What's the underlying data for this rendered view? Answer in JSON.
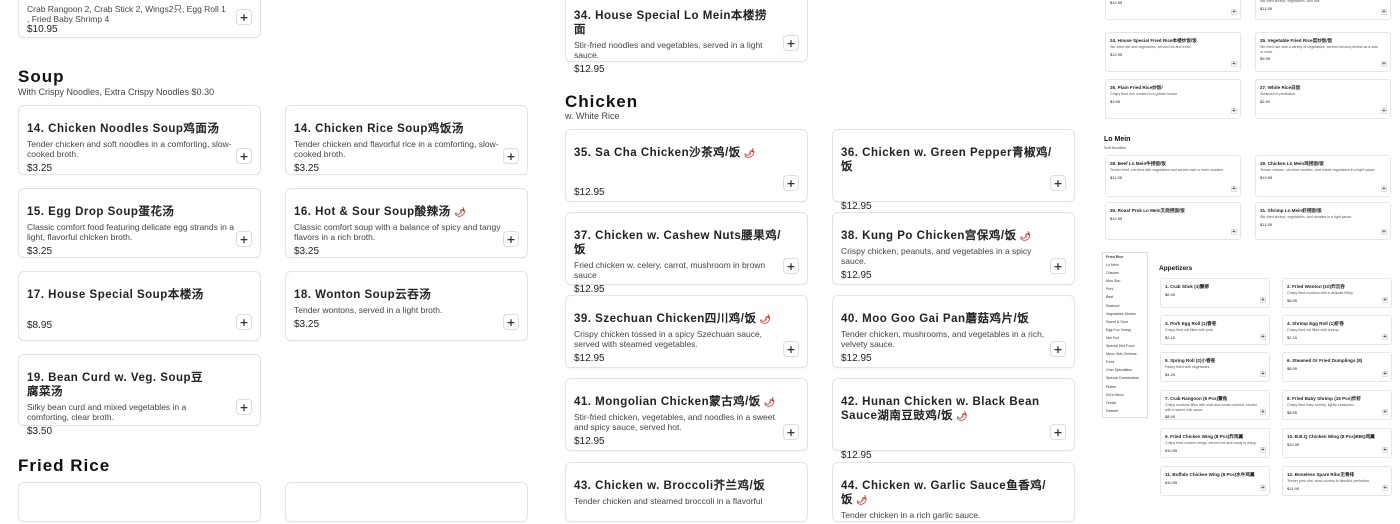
{
  "partial_top": {
    "desc": "Crab Rangoon 2, Crab Stick 2, Wings2只, Egg Roll 1 , Fried Baby Shrimp 4",
    "price": "$10.95"
  },
  "item34": {
    "title": "34. House Special Lo Mein本楼捞面",
    "desc": "Stir-fried noodles and vegetables, served in a light sauce.",
    "price": "$12.95"
  },
  "soup": {
    "title": "Soup",
    "subtitle": "With Crispy Noodles, Extra Crispy Noodles $0.30",
    "items": [
      {
        "title": "14. Chicken Noodles Soup鸡面汤",
        "desc": "Tender chicken and soft noodles in a comforting, slow-cooked broth.",
        "price": "$3.25"
      },
      {
        "title": "14. Chicken Rice Soup鸡饭汤",
        "desc": "Tender chicken and flavorful rice in a comforting, slow-cooked broth.",
        "price": "$3.25"
      },
      {
        "title": "15. Egg Drop Soup蛋花汤",
        "desc": "Classic comfort food featuring delicate egg strands in a light, flavorful chicken broth.",
        "price": "$3.25"
      },
      {
        "title": "16. Hot & Sour Soup酸辣汤",
        "desc": "Classic comfort soup with a balance of spicy and tangy flavors in a rich broth.",
        "price": "$3.25"
      },
      {
        "title": "17. House Special Soup本楼汤",
        "desc": "",
        "price": "$8.95"
      },
      {
        "title": "18. Wonton Soup云吞汤",
        "desc": "Tender wontons, served in a light broth.",
        "price": "$3.25"
      },
      {
        "title": "19. Bean Curd w. Veg. Soup豆腐菜汤",
        "desc": "Silky bean curd and mixed vegetables in a comforting, clear broth.",
        "price": "$3.50"
      }
    ]
  },
  "fried_rice": {
    "title": "Fried Rice"
  },
  "chicken": {
    "title": "Chicken",
    "subtitle": "w. White Rice",
    "items": [
      {
        "title": "35. Sa Cha Chicken沙茶鸡/饭",
        "desc": "",
        "price": "$12.95"
      },
      {
        "title": "36. Chicken w. Green Pepper青椒鸡/饭",
        "desc": "",
        "price": "$12.95"
      },
      {
        "title": "37. Chicken w. Cashew Nuts腰果鸡/饭",
        "desc": "Fried chicken w. celery, carrot, mushroom in brown sauce",
        "price": "$12.95"
      },
      {
        "title": "38. Kung Po Chicken宫保鸡/饭",
        "desc": "Crispy chicken, peanuts, and vegetables in a spicy sauce.",
        "price": "$12.95"
      },
      {
        "title": "39. Szechuan Chicken四川鸡/饭",
        "desc": "Crispy chicken tossed in a spicy Szechuan sauce, served with steamed vegetables.",
        "price": "$12.95"
      },
      {
        "title": "40. Moo Goo Gai Pan蘑菇鸡片/饭",
        "desc": "Tender chicken, mushrooms, and vegetables in a rich, velvety sauce.",
        "price": "$12.95"
      },
      {
        "title": "41. Mongolian Chicken蒙古鸡/饭",
        "desc": "Stir-fried chicken, vegetables, and noodles in a sweet and spicy sauce, served hot.",
        "price": "$12.95"
      },
      {
        "title": "42. Hunan Chicken w. Black Bean Sauce湖南豆豉鸡/饭",
        "desc": "",
        "price": "$12.95"
      },
      {
        "title": "43. Chicken w. Broccoli芥兰鸡/饭",
        "desc": "Tender chicken and steamed broccoli in a flavorful",
        "price": ""
      },
      {
        "title": "44. Chicken w. Garlic Sauce鱼香鸡/饭",
        "desc": "Tender chicken in a rich garlic sauce.",
        "price": ""
      }
    ]
  },
  "thumb": {
    "fr_items": [
      {
        "title": "",
        "desc": "",
        "price": "$10.95"
      },
      {
        "title": "",
        "desc": "Stir-fried shrimp, vegetables, and rice",
        "price": "$11.95"
      },
      {
        "title": "24. House Special Fried Rice本楼炒饭/饭",
        "desc": "Stir-fried rice and vegetables, served hot and fresh.",
        "price": "$12.95"
      },
      {
        "title": "25. Vegetable Fried Rice菜炒饭/饭",
        "desc": "Stir-fried rice with a variety of vegetables, served hot and perfect as a side or meal.",
        "price": "$9.95"
      },
      {
        "title": "26. Plain Fried Rice炒饭/",
        "desc": "Crispy fried rice cooked to a golden brown.",
        "price": "$3.95"
      },
      {
        "title": "27. White Rice白饭",
        "desc": "Steamed to perfection.",
        "price": "$2.50"
      }
    ],
    "lomein": {
      "title": "Lo Mein",
      "subtitle": "Soft Noodles"
    },
    "lm_items": [
      {
        "title": "28. Beef Lo Mein牛捞面/饭",
        "desc": "Tender beef, stir-fried with vegetables and served over lo mein noodles.",
        "price": "$11.95"
      },
      {
        "title": "29. Chicken Lo Mein鸡捞面/饭",
        "desc": "Tender chicken, stir-fried noodles, and mixed vegetables in a light sauce.",
        "price": "$10.95"
      },
      {
        "title": "30. Roast Prok Lo Mein叉烧捞面/饭",
        "desc": "",
        "price": "$10.95"
      },
      {
        "title": "31. Shrimp Lo Mein虾捞面/饭",
        "desc": "Stir-fried shrimp, vegetables, and noodles in a light sauce.",
        "price": "$11.95"
      }
    ],
    "nav": [
      "Fried Rice",
      "Lo Mein",
      "Chicken",
      "Moo Shu",
      "Pork",
      "Beef",
      "Seafood",
      "Vegetables Dishes",
      "Sweet & Sour",
      "Egg Foo Young",
      "Mei Fun",
      "Special Diet Food",
      "Menu Sub-Chinese Food",
      "Chef Specialties",
      "Special Combination Plates",
      "Kid's Menu",
      "Drinks",
      "Dessert"
    ],
    "appetizers": {
      "title": "Appetizers"
    },
    "app_items": [
      {
        "title": "1. Crab Stick (4)蟹柳",
        "desc": "",
        "price": "$6.95"
      },
      {
        "title": "2. Fried Wonton (10)炸云吞",
        "desc": "Crispy fried wontons with a delicate filling.",
        "price": "$6.95"
      },
      {
        "title": "3. Pork Egg Roll (1)春卷",
        "desc": "Crispy fried roll filled with pork.",
        "price": "$2.15"
      },
      {
        "title": "4. Shrimp Egg Roll (1)虾卷",
        "desc": "Crispy fried roll filled with shrimp.",
        "price": "$2.15"
      },
      {
        "title": "5. Spring Roll (2)小春卷",
        "desc": "Pastry filled with vegetables.",
        "price": "$4.25"
      },
      {
        "title": "6. Steamed Or Fried Dumplings (8)",
        "desc": "",
        "price": "$8.95"
      },
      {
        "title": "7. Crab Rangoon (8 Pcs)蟹角",
        "desc": "Crispy wontons filled with crab and cream cheese, served with a sweet chili sauce.",
        "price": "$8.95"
      },
      {
        "title": "8. Fried Baby Shrimp (15 Pcs)炸虾",
        "desc": "Crispy fried baby shrimp, lightly seasoned.",
        "price": "$8.95"
      },
      {
        "title": "9. Fried Chicken Wing (8 Pcs)炸鸡翼",
        "desc": "Crispy fried chicken wings, served hot and ready to enjoy.",
        "price": "$10.95"
      },
      {
        "title": "10. B.B.Q Chicken Wing (8 Pcs)BBQ鸡翼",
        "desc": "",
        "price": "$10.95"
      },
      {
        "title": "11. Buffalo Chicken Wing (8 Pcs)水牛鸡翼",
        "desc": "",
        "price": "$10.95"
      },
      {
        "title": "12. Boneless Spare Ribs无骨排",
        "desc": "Tender pork ribs, slow-cooked to flavorful perfection.",
        "price": "$11.95"
      }
    ]
  },
  "icons": {
    "add": "plus-icon",
    "spicy": "chili-pepper-icon"
  }
}
